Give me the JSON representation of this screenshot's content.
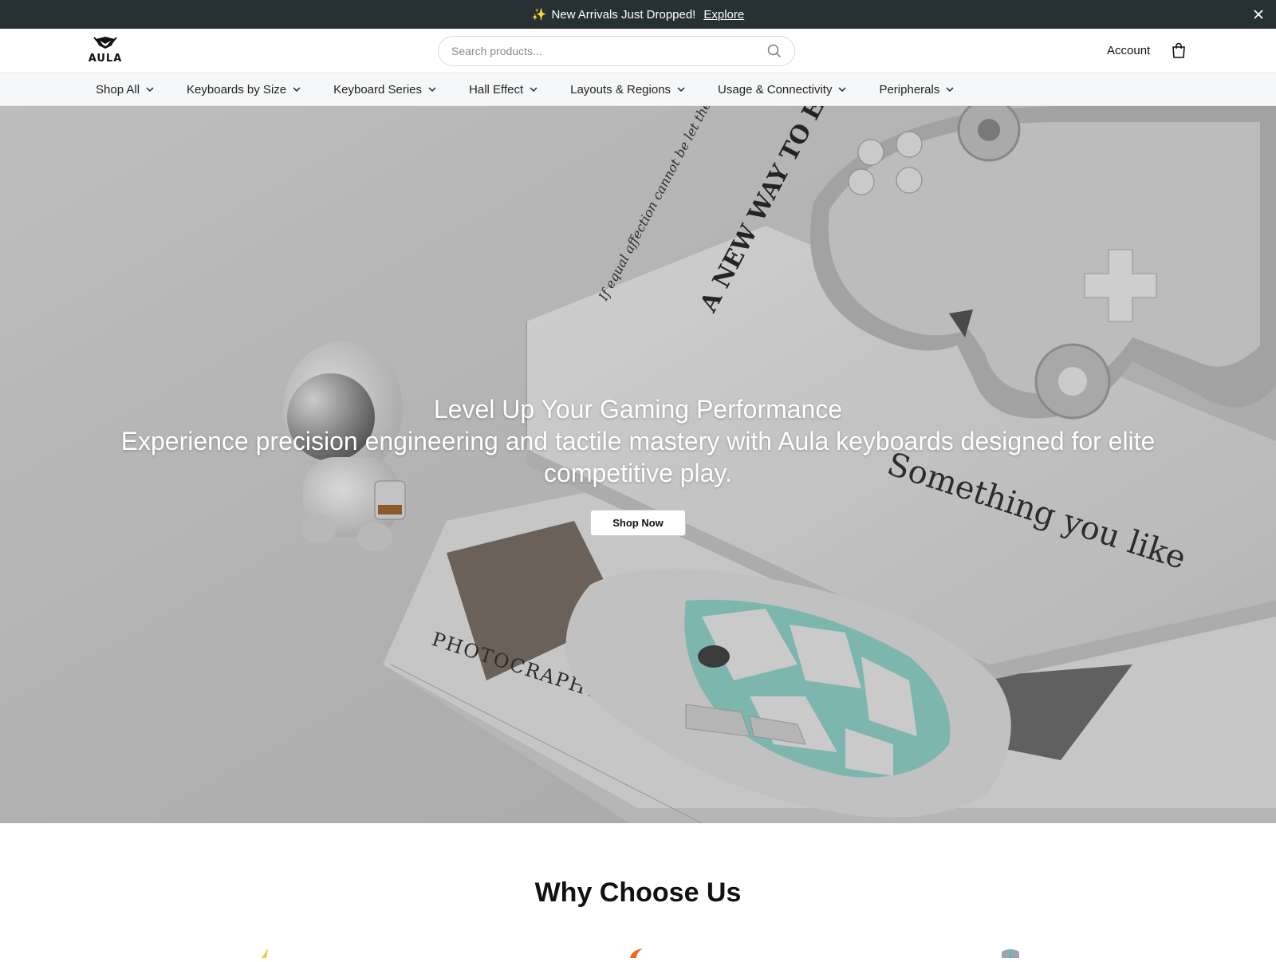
{
  "announcement": {
    "spark": "✨",
    "text": "New Arrivals Just Dropped!",
    "link": "Explore"
  },
  "header": {
    "logo_text": "AULA",
    "search_placeholder": "Search products...",
    "account_label": "Account"
  },
  "nav": {
    "items": [
      {
        "label": "Shop All"
      },
      {
        "label": "Keyboards by Size"
      },
      {
        "label": "Keyboard Series"
      },
      {
        "label": "Hall Effect"
      },
      {
        "label": "Layouts & Regions"
      },
      {
        "label": "Usage & Connectivity"
      },
      {
        "label": "Peripherals"
      }
    ]
  },
  "hero": {
    "title": "Level Up Your Gaming Performance",
    "subtitle": "Experience precision engineering and tactile mastery with Aula keyboards designed for elite competitive play.",
    "cta": "Shop Now"
  },
  "why": {
    "title": "Why Choose Us"
  },
  "colors": {
    "announcement_bg": "#273033",
    "nav_bg": "#f6f7f8",
    "accent_yellow": "#f5c542",
    "accent_orange": "#ee6a1f",
    "accent_teal": "#33c3b8"
  }
}
